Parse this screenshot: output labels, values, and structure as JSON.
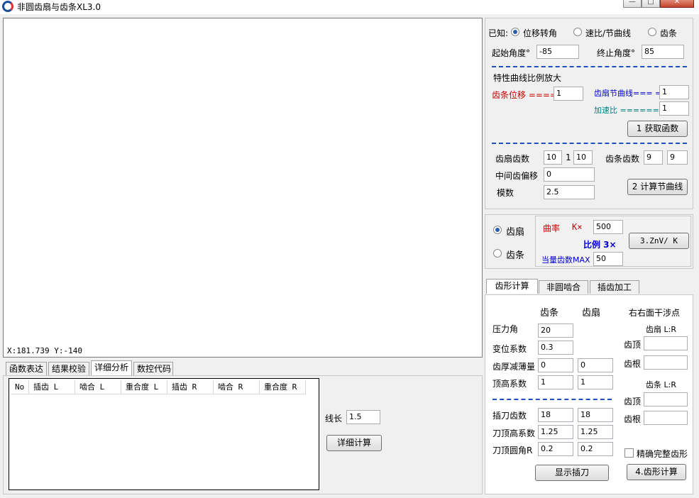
{
  "window": {
    "title": "非圆齿扇与齿条XL3.0",
    "btn_min": "—",
    "btn_max": "□",
    "btn_close": "✕"
  },
  "canvas": {
    "coords": "X:181.739  Y:-140"
  },
  "bottom_tabs": [
    "函数表达",
    "结果校验",
    "详细分析",
    "数控代码"
  ],
  "table": {
    "headers": [
      "No",
      "插齿 L",
      "啮合 L",
      "重合度 L",
      "插齿 R",
      "啮合 R",
      "重合度 R"
    ]
  },
  "detail": {
    "line_len_label": "线长",
    "line_len_value": "1.5",
    "calc_btn": "详细计算"
  },
  "known": {
    "label": "已知:",
    "options": [
      "位移转角",
      "速比/节曲线",
      "齿条"
    ],
    "start_label": "起始角度°",
    "start_value": "-85",
    "end_label": "终止角度°",
    "end_value": "85",
    "dash_line": "————————————————————————————"
  },
  "scale": {
    "title": "特性曲线比例放大",
    "rack_label": "齿条位移 ====",
    "rack_value": "1",
    "sector_label": "齿扇节曲线=== =",
    "sector_value": "1",
    "accel_label": "加速比 ====== :=",
    "accel_value": "1",
    "btn": "1 获取函数"
  },
  "teeth": {
    "sector_label": "齿扇齿数",
    "sector_v1": "10",
    "sep": "1",
    "sector_v2": "10",
    "rack_label": "齿条齿数",
    "rack_v1": "9",
    "rack_v2": "9",
    "mid_label": "中间齿偏移",
    "mid_value": "0",
    "module_label": "模数",
    "module_value": "2.5",
    "btn": "2 计算节曲线"
  },
  "curv": {
    "opt1": "齿扇",
    "opt2": "齿条",
    "curv_label": "曲率",
    "k_label": "K×",
    "k_value": "500",
    "ratio_label": "比例 3×",
    "eq_label": "当量齿数MAX",
    "eq_value": "50",
    "btn": "3.ZnV/ K"
  },
  "right_tabs": [
    "齿形计算",
    "非圆啮合",
    "插齿加工"
  ],
  "form": {
    "col_rack": "齿条",
    "col_sector": "齿扇",
    "interf": "右右面干涉点",
    "rows": [
      {
        "label": "压力角",
        "rack": "20",
        "sector": ""
      },
      {
        "label": "变位系数",
        "rack": "0.3",
        "sector": ""
      },
      {
        "label": "齿厚减薄量",
        "rack": "0",
        "sector": "0"
      },
      {
        "label": "顶高系数",
        "rack": "1",
        "sector": "1"
      }
    ],
    "dash_line": "—————————————————",
    "rows2": [
      {
        "label": "插刀齿数",
        "rack": "18",
        "sector": "18"
      },
      {
        "label": "刀顶高系数",
        "rack": "1.25",
        "sector": "1.25"
      },
      {
        "label": "刀顶圆角R",
        "rack": "0.2",
        "sector": "0.2"
      }
    ],
    "sector_lr": "齿扇 L:R",
    "rack_lr": "齿条 L:R",
    "tip": "齿顶",
    "root": "齿根",
    "exact_label": "精确完整齿形",
    "show_btn": "显示插刀",
    "calc_btn": "4.齿形计算"
  },
  "colors": {
    "red": "#cc0000",
    "blue": "#0000cc",
    "teal": "#008080"
  }
}
